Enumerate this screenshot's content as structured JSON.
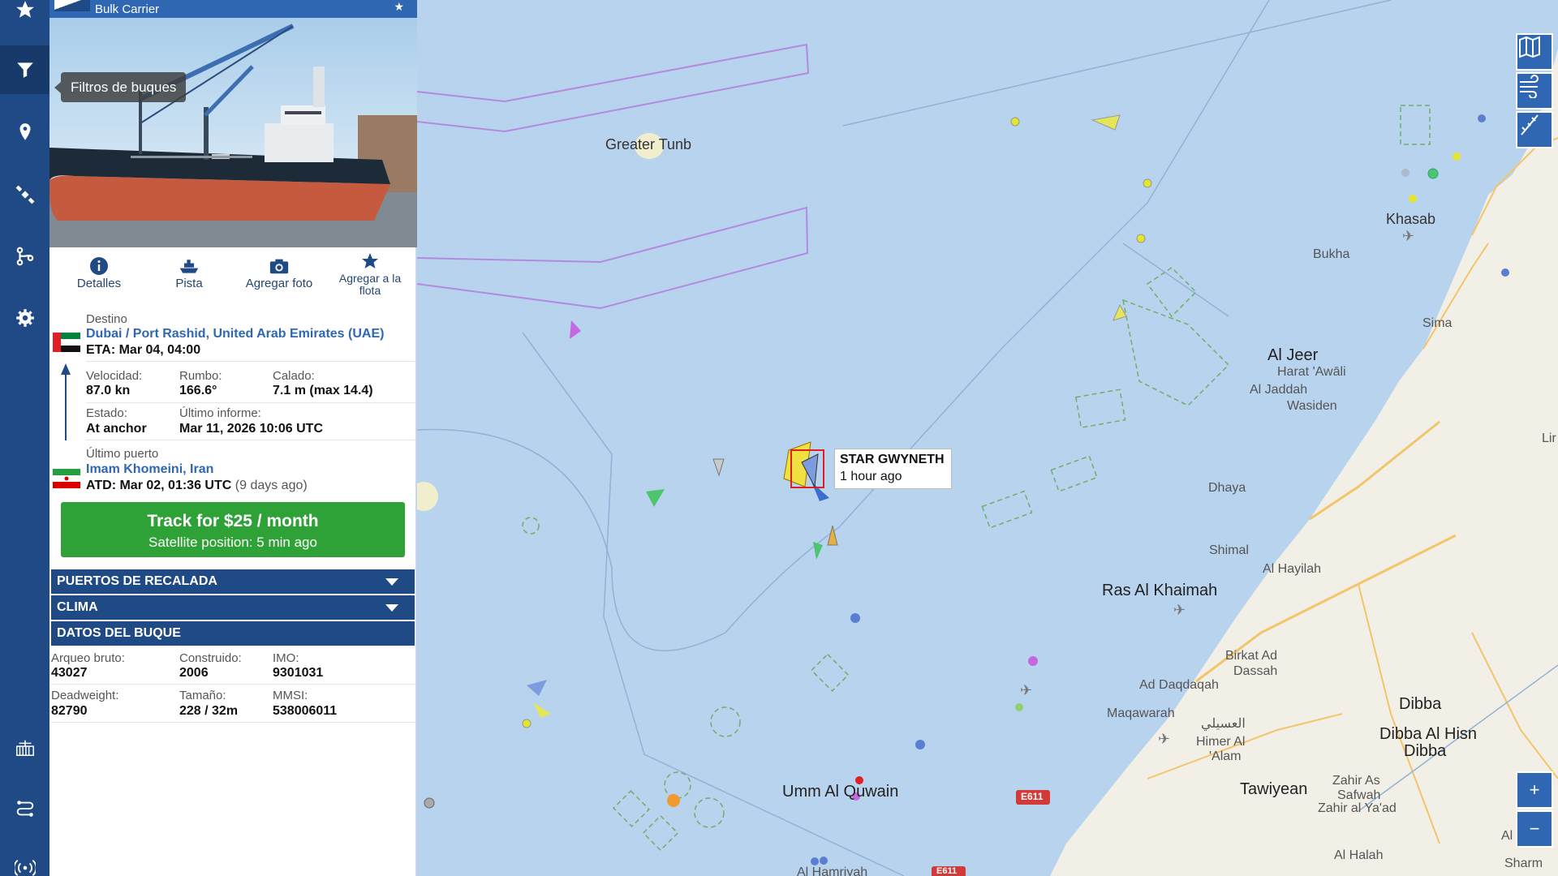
{
  "panel": {
    "vessel_type": "Bulk Carrier",
    "tooltip": "Filtros de buques",
    "actions": {
      "details": "Detalles",
      "track": "Pista",
      "add_photo": "Agregar foto",
      "add_fleet_line1": "Agregar a la",
      "add_fleet_line2": "flota"
    },
    "destination": {
      "label": "Destino",
      "port": "Dubai / Port Rashid, United Arab Emirates (UAE)",
      "eta": "ETA: Mar 04, 04:00"
    },
    "speed": {
      "label": "Velocidad:",
      "value": "87.0 kn"
    },
    "course": {
      "label": "Rumbo:",
      "value": "166.6°"
    },
    "draught": {
      "label": "Calado:",
      "value": "7.1 m (max 14.4)"
    },
    "status": {
      "label": "Estado:",
      "value": "At anchor"
    },
    "last_report": {
      "label": "Último informe:",
      "value": "Mar 11, 2026 10:06 UTC"
    },
    "last_port": {
      "label": "Último puerto",
      "port": "Imam Khomeini, Iran",
      "atd": "ATD: Mar 02, 01:36 UTC",
      "ago": "(9 days ago)"
    },
    "track_button": {
      "title": "Track for $25 / month",
      "subtitle": "Satellite position: 5 min ago"
    },
    "sections": {
      "ports_of_call": "PUERTOS DE RECALADA",
      "weather": "CLIMA",
      "vessel_data": "DATOS DEL BUQUE"
    },
    "vessel_data": {
      "gross_tonnage": {
        "label": "Arqueo bruto:",
        "value": "43027"
      },
      "built": {
        "label": "Construido:",
        "value": "2006"
      },
      "imo": {
        "label": "IMO:",
        "value": "9301031"
      },
      "deadweight": {
        "label": "Deadweight:",
        "value": "82790"
      },
      "size": {
        "label": "Tamaño:",
        "value": "228 / 32m"
      },
      "mmsi": {
        "label": "MMSI:",
        "value": "538006011"
      }
    }
  },
  "map": {
    "ship_label": {
      "name": "STAR GWYNETH",
      "time": "1 hour ago"
    },
    "places": {
      "greater_tunb": "Greater Tunb",
      "khasab": "Khasab",
      "bukha": "Bukha",
      "sima": "Sima",
      "al_jeer": "Al Jeer",
      "harat_awali": "Harat 'Awāli",
      "al_jaddah": "Al Jaddah",
      "wasiden": "Wasiden",
      "lir": "Lir",
      "dhaya": "Dhaya",
      "shimal": "Shimal",
      "al_hayilah": "Al Hayilah",
      "ras_al_khaimah": "Ras Al Khaimah",
      "birkat_ad_dassah_1": "Birkat Ad",
      "birkat_ad_dassah_2": "Dassah",
      "ad_daqdaqah": "Ad Daqdaqah",
      "maqawarah": "Maqawarah",
      "arabic_town": "العسيلي",
      "himer_1": "Himer Al",
      "himer_2": "'Alam",
      "dibba": "Dibba",
      "dibba_al_hisn_1": "Dibba Al Hisn",
      "dibba_al_hisn_2": "Dibba",
      "umm_al_quwain": "Umm Al Quwain",
      "tawiyean": "Tawiyean",
      "zahir_1": "Zahir As",
      "zahir_2": "Safwah",
      "zahir_3": "Zahir al Ya'ad",
      "al_aqah": "Al Aqah",
      "al_halah": "Al Halah",
      "sharm": "Sharm",
      "hamriyah": "Al Hamriyah",
      "road_e611": "E611",
      "road_e611b": "E611"
    },
    "controls": {
      "zoom_in": "+",
      "zoom_out": "−"
    }
  },
  "colors": {
    "rail": "#1f4a86",
    "header": "#2f67b3",
    "section": "#1f4a86",
    "track_button": "#2ea236",
    "sea": "#b8d3ee",
    "land": "#f2efe6",
    "link": "#2f67b3"
  }
}
